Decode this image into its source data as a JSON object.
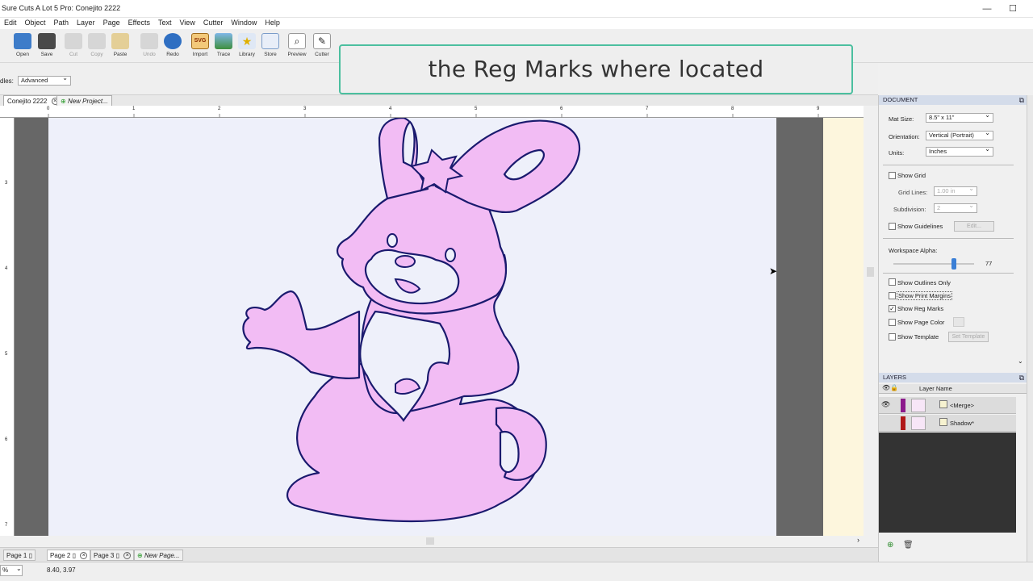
{
  "window": {
    "title": "Sure Cuts A Lot 5 Pro: Conejito 2222",
    "minimize": "—",
    "maximize": "☐"
  },
  "menu": [
    "Edit",
    "Object",
    "Path",
    "Layer",
    "Page",
    "Effects",
    "Text",
    "View",
    "Cutter",
    "Window",
    "Help"
  ],
  "toolbar": {
    "items": [
      {
        "label": "Open",
        "icon": "open-icon"
      },
      {
        "label": "Save",
        "icon": "save-icon"
      },
      {
        "label": "Cut",
        "icon": "cut-icon"
      },
      {
        "label": "Copy",
        "icon": "copy-icon"
      },
      {
        "label": "Paste",
        "icon": "paste-icon"
      },
      {
        "label": "Undo",
        "icon": "undo-icon"
      },
      {
        "label": "Redo",
        "icon": "redo-icon"
      },
      {
        "label": "Import",
        "icon": "import-icon"
      },
      {
        "label": "Trace",
        "icon": "trace-icon"
      },
      {
        "label": "Library",
        "icon": "library-icon"
      },
      {
        "label": "Store",
        "icon": "store-icon"
      },
      {
        "label": "Preview",
        "icon": "preview-icon"
      },
      {
        "label": "Cutter",
        "icon": "cutter-icon"
      }
    ],
    "import_badge": "SVG"
  },
  "options": {
    "handles_label": "dles:",
    "handles_value": "Advanced"
  },
  "caption": "the Reg Marks where located",
  "doc_tabs": {
    "active": "Conejito 2222",
    "new": "New Project..."
  },
  "rulers": {
    "top": [
      "0",
      "1",
      "2",
      "3",
      "4",
      "5",
      "6",
      "7",
      "8",
      "9"
    ],
    "side": [
      "3",
      "4",
      "5",
      "6",
      "7"
    ]
  },
  "page_tabs": {
    "pages": [
      "Page 1",
      "Page 2",
      "Page 3"
    ],
    "new": "New Page..."
  },
  "status": {
    "zoom": "%",
    "coords": "8.40, 3.97"
  },
  "document_panel": {
    "title": "DOCUMENT",
    "mat_size_label": "Mat Size:",
    "mat_size": "8.5\" x 11\"",
    "orientation_label": "Orientation:",
    "orientation": "Vertical (Portrait)",
    "units_label": "Units:",
    "units": "Inches",
    "show_grid": "Show Grid",
    "grid_lines_label": "Grid Lines:",
    "grid_lines": "1.00 in",
    "subdivision_label": "Subdivision:",
    "subdivision": "2",
    "show_guidelines": "Show Guidelines",
    "edit_button": "Edit...",
    "workspace_alpha_label": "Workspace Alpha:",
    "workspace_alpha": "77",
    "show_outlines_only": "Show Outlines Only",
    "show_print_margins": "Show Print Margins",
    "show_reg_marks": "Show Reg Marks",
    "show_page_color": "Show Page Color",
    "show_template": "Show Template",
    "set_template": "Set Template",
    "reg_marks_checked": true
  },
  "layers_panel": {
    "title": "LAYERS",
    "col_name": "Layer Name",
    "layers": [
      {
        "name": "<Merge>",
        "color": "#8b1a8b"
      },
      {
        "name": "Shadow*",
        "color": "#b01818"
      }
    ]
  },
  "colors": {
    "accent_border": "#4bbf9f",
    "bunny_fill": "#f2bcf4",
    "bunny_outline": "#1a1a6e"
  }
}
